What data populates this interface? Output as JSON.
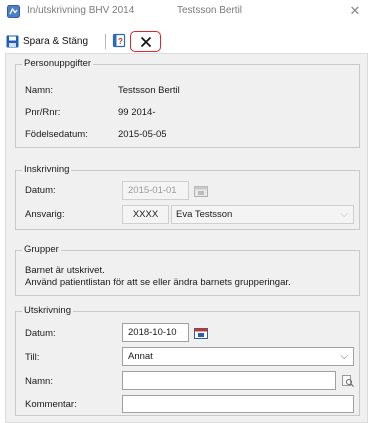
{
  "window": {
    "title": "In/utskrivning BHV 2014",
    "patient": "Testsson Bertil"
  },
  "toolbar": {
    "save_label": "Spara & Stäng"
  },
  "personuppgifter": {
    "legend": "Personuppgifter",
    "name_label": "Namn:",
    "name_value": "Testsson Bertil",
    "pnr_label": "Pnr/Rnr:",
    "pnr_value": "99 2014-",
    "birth_label": "Födelsedatum:",
    "birth_value": "2015-05-05"
  },
  "inskrivning": {
    "legend": "Inskrivning",
    "date_label": "Datum:",
    "date_value": "2015-01-01",
    "responsible_label": "Ansvarig:",
    "responsible_code": "XXXX",
    "responsible_name": "Eva Testsson"
  },
  "grupper": {
    "legend": "Grupper",
    "line1": "Barnet är utskrivet.",
    "line2": "Använd patientlistan för att se eller ändra barnets grupperingar."
  },
  "utskrivning": {
    "legend": "Utskrivning",
    "date_label": "Datum:",
    "date_value": "2018-10-10",
    "to_label": "Till:",
    "to_value": "Annat",
    "name_label": "Namn:",
    "name_value": "",
    "comment_label": "Kommentar:",
    "comment_value": ""
  },
  "colors": {
    "highlight": "#e0262a",
    "save_icon": "#1f5fb3"
  }
}
